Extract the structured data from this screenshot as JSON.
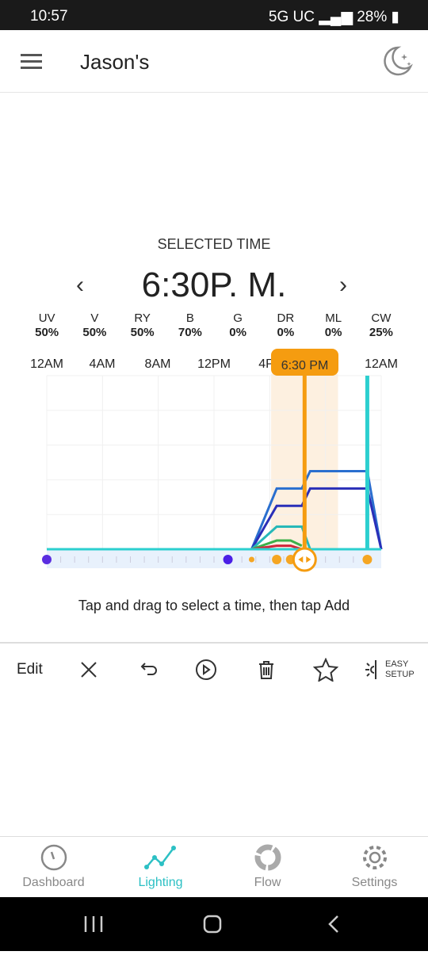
{
  "status_bar": {
    "time": "10:57",
    "network": "5G UC",
    "battery": "28%"
  },
  "header": {
    "title": "Jason's",
    "theme_icon": "moon-stars-icon"
  },
  "selected_time": {
    "label": "SELECTED TIME",
    "value": "6:30P. M."
  },
  "channels": [
    {
      "name": "UV",
      "value": "50%"
    },
    {
      "name": "V",
      "value": "50%"
    },
    {
      "name": "RY",
      "value": "50%"
    },
    {
      "name": "B",
      "value": "70%"
    },
    {
      "name": "G",
      "value": "0%"
    },
    {
      "name": "DR",
      "value": "0%"
    },
    {
      "name": "ML",
      "value": "0%"
    },
    {
      "name": "CW",
      "value": "25%"
    }
  ],
  "chart_data": {
    "type": "line",
    "x_ticks": [
      "12AM",
      "4AM",
      "8AM",
      "12PM",
      "4P",
      "12AM"
    ],
    "xlim": [
      0,
      24
    ],
    "ylim": [
      0,
      100
    ],
    "grid": true,
    "selected_label": "6:30 PM",
    "selected_hour": 18.5,
    "highlight_range": [
      16.1,
      20.9
    ],
    "series": [
      {
        "color": "#2a6fcf",
        "points": [
          [
            14.7,
            0
          ],
          [
            16.5,
            35
          ],
          [
            18.3,
            35
          ],
          [
            18.9,
            45
          ],
          [
            23,
            45
          ],
          [
            24,
            0
          ]
        ]
      },
      {
        "color": "#2a2fb8",
        "points": [
          [
            14.7,
            0
          ],
          [
            16.5,
            25
          ],
          [
            18.3,
            25
          ],
          [
            18.9,
            35
          ],
          [
            23,
            35
          ],
          [
            24,
            0
          ]
        ]
      },
      {
        "color": "#27b8b8",
        "points": [
          [
            14.7,
            0
          ],
          [
            16.5,
            13
          ],
          [
            18.3,
            13
          ],
          [
            18.9,
            0
          ]
        ]
      },
      {
        "color": "#3cb04a",
        "points": [
          [
            14.7,
            0
          ],
          [
            16.5,
            5
          ],
          [
            17.5,
            5
          ],
          [
            18.3,
            2
          ]
        ]
      },
      {
        "color": "#d0243a",
        "points": [
          [
            14.7,
            0
          ],
          [
            16.5,
            2
          ],
          [
            17.5,
            2
          ],
          [
            18.3,
            0
          ]
        ]
      },
      {
        "color": "#2ccfcf",
        "points": [
          [
            0,
            0
          ],
          [
            24,
            0
          ]
        ]
      },
      {
        "color": "#2ccfcf",
        "points": [
          [
            23,
            0
          ],
          [
            23,
            100
          ]
        ]
      }
    ],
    "points": [
      {
        "hour": 0,
        "color": "#5b2ee0"
      },
      {
        "hour": 13,
        "color": "#4a1fe6"
      },
      {
        "hour": 14.7,
        "color": "#f5a623",
        "small": true
      },
      {
        "hour": 16.5,
        "color": "#f5a623"
      },
      {
        "hour": 17.5,
        "color": "#f5a623"
      },
      {
        "hour": 23,
        "color": "#f5a623"
      }
    ],
    "accent": "#f59c10"
  },
  "hint": "Tap and drag to select a time, then tap Add",
  "toolbar": {
    "edit": "Edit",
    "easy_setup_1": "EASY",
    "easy_setup_2": "SETUP"
  },
  "nav": [
    {
      "label": "Dashboard"
    },
    {
      "label": "Lighting",
      "active": true
    },
    {
      "label": "Flow"
    },
    {
      "label": "Settings"
    }
  ]
}
